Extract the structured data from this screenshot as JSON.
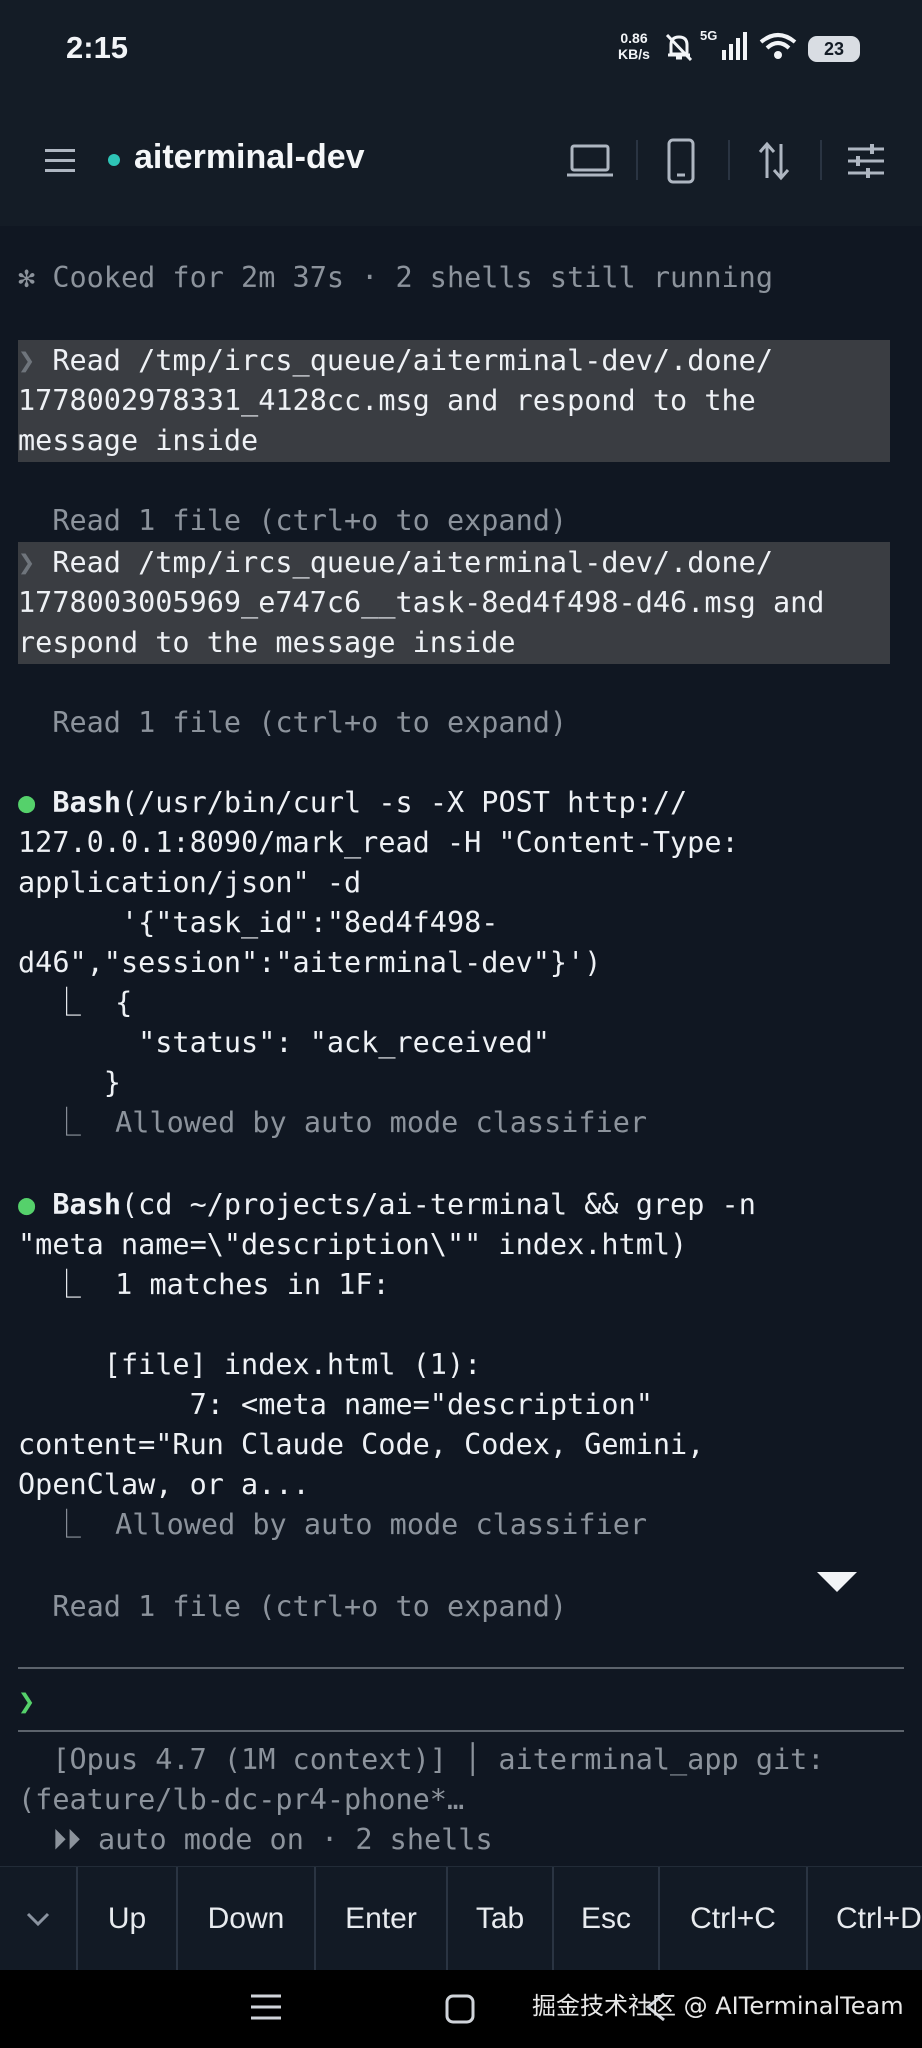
{
  "status_bar": {
    "time": "2:15",
    "net_speed_value": "0.86",
    "net_speed_unit": "KB/s",
    "network_label": "5G",
    "battery": "23"
  },
  "app_bar": {
    "session_name": "aiterminal-dev",
    "session_status_color": "#2ec4b6"
  },
  "terminal": {
    "cooked_status": "✻ Cooked for 2m 37s · 2 shells still running",
    "prompt_block_1": {
      "chevron": "❯",
      "lines": [
        " Read /tmp/ircs_queue/aiterminal-dev/.done/",
        "1778002978331_4128cc.msg and respond to the",
        "message inside"
      ]
    },
    "read_note_1": "  Read 1 file (ctrl+o to expand)",
    "prompt_block_2": {
      "chevron": "❯",
      "lines": [
        " Read /tmp/ircs_queue/aiterminal-dev/.done/",
        "1778003005969_e747c6__task-8ed4f498-d46.msg and",
        "respond to the message inside"
      ]
    },
    "read_note_2": "  Read 1 file (ctrl+o to expand)",
    "bash_1": {
      "bullet": "●",
      "tool": "Bash",
      "command_lines": [
        "(/usr/bin/curl -s -X POST http://",
        "127.0.0.1:8090/mark_read -H \"Content-Type:",
        "application/json\" -d",
        "      '{\"task_id\":\"8ed4f498-",
        "d46\",\"session\":\"aiterminal-dev\"}')"
      ],
      "output_lines": [
        "  ⎿  {",
        "       \"status\": \"ack_received\"",
        "     }"
      ],
      "allowed_note": "  ⎿  Allowed by auto mode classifier"
    },
    "bash_2": {
      "bullet": "●",
      "tool": "Bash",
      "command_lines": [
        "(cd ~/projects/ai-terminal && grep -n",
        "\"meta name=\\\"description\\\"\" index.html)"
      ],
      "output_lines": [
        "  ⎿  1 matches in 1F:",
        "",
        "     [file] index.html (1):",
        "          7: <meta name=\"description\"",
        "content=\"Run Claude Code, Codex, Gemini,",
        "OpenClaw, or a..."
      ],
      "allowed_note": "  ⎿  Allowed by auto mode classifier"
    },
    "read_note_3": "  Read 1 file (ctrl+o to expand)",
    "prompt_symbol": "❯",
    "footer_lines": [
      "  [Opus 4.7 (1M context)] │ aiterminal_app git:",
      "(feature/lb-dc-pr4-phone*…",
      "  ⏵⏵ auto mode on · 2 shells"
    ]
  },
  "key_bar": {
    "keys": [
      "Up",
      "Down",
      "Enter",
      "Tab",
      "Esc",
      "Ctrl+C",
      "Ctrl+D"
    ]
  },
  "watermark": "掘金技术社区 @ AITerminalTeam",
  "icons": {
    "menu": "hamburger-menu-icon",
    "laptop": "laptop-icon",
    "phone": "phone-icon",
    "transfer": "up-down-arrows-icon",
    "settings": "sliders-icon"
  }
}
